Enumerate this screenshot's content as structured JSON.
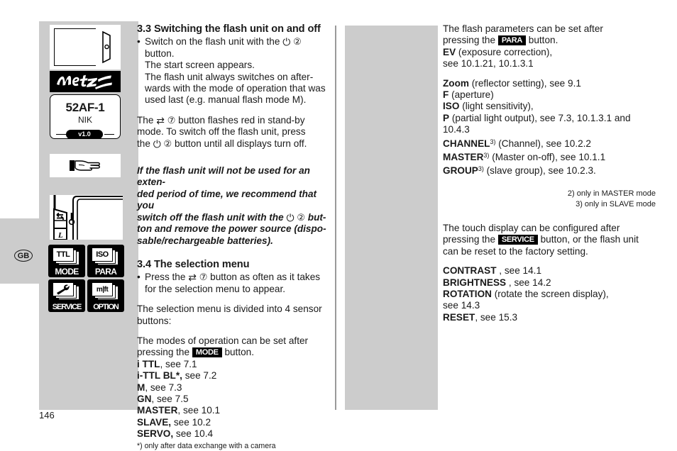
{
  "page": {
    "number": "146",
    "language_tab": "GB"
  },
  "figures": {
    "start_screen": {
      "model": "52AF-1",
      "brand_variant": "NIK",
      "version": "v1.0",
      "logo_text": "Metz"
    },
    "sensor_buttons": [
      {
        "icon_label": "TTL",
        "caption": "MODE"
      },
      {
        "icon_label": "ISO",
        "caption": "PARA"
      },
      {
        "icon_label": "wrench",
        "caption": "SERVICE"
      },
      {
        "icon_label": "m|ft",
        "caption": "OPTION"
      }
    ]
  },
  "middle_column": {
    "section_3_3": {
      "heading": "3.3 Switching the flash unit on and off",
      "bullet_line_1a": "Switch on the flash unit with the",
      "bullet_line_1b": "button.",
      "bullet_line_2": "The start screen appears.",
      "bullet_line_3": "The flash unit always switches on after-",
      "bullet_line_4": "wards with the mode of operation that was",
      "bullet_line_5": "used last (e.g. manual flash mode M).",
      "para_2a": "The",
      "para_2b": "button flashes red in stand-by",
      "para_2c": "mode. To switch off the flash unit, press",
      "para_2d": "the",
      "para_2e": "button until all displays turn off."
    },
    "warning": {
      "line_1": "If the flash unit will not be used for an exten-",
      "line_2": "ded period of time, we recommend that you",
      "line_3": "switch off the flash unit with the",
      "line_4": "but-",
      "line_5": "ton and remove the power source (dispo-",
      "line_6": "sable/rechargeable batteries)."
    },
    "section_3_4": {
      "heading": "3.4 The selection menu",
      "bullet_1a": "Press the",
      "bullet_1b": "button as often as it takes",
      "bullet_1c": "for the selection menu to appear.",
      "para_1a": "The selection menu is divided into 4 sensor",
      "para_1b": "buttons:",
      "para_2a": "The modes of operation can be set after",
      "para_2b": "pressing the",
      "para_2c": "button.",
      "mode_badge": "MODE",
      "modes": [
        {
          "name": "i TTL",
          "ref": ", see 7.1"
        },
        {
          "name": "i-TTL BL*,",
          "ref": " see 7.2"
        },
        {
          "name": "M",
          "ref": ", see 7.3"
        },
        {
          "name": "GN",
          "ref": ", see 7.5"
        },
        {
          "name": "MASTER",
          "ref": ", see 10.1"
        },
        {
          "name": "SLAVE,",
          "ref": " see 10.2"
        },
        {
          "name": "SERVO,",
          "ref": " see 10.4"
        }
      ],
      "footnote": "*) only after data exchange with a camera"
    }
  },
  "right_column": {
    "para_intro_a": "The flash parameters can be set after",
    "para_intro_b": "pressing the",
    "para_intro_c": "button.",
    "para_badge": "PARA",
    "params_first": [
      {
        "name": "EV",
        "ref": " (exposure correction),"
      },
      {
        "name": "",
        "ref": "see 10.1.21, 10.1.3.1"
      }
    ],
    "params": [
      {
        "name": "Zoom",
        "sup": "",
        "ref": " (reflector setting), see 9.1"
      },
      {
        "name": "F",
        "sup": "",
        "ref": " (aperture)"
      },
      {
        "name": "ISO",
        "sup": "",
        "ref": " (light sensitivity),"
      },
      {
        "name": "P",
        "sup": "",
        "ref": " (partial light output), see 7.3, 10.1.3.1 and"
      },
      {
        "name": "",
        "sup": "",
        "ref": "10.4.3"
      },
      {
        "name": "CHANNEL",
        "sup": "3)",
        "ref": " (Channel), see 10.2.2"
      },
      {
        "name": "MASTER",
        "sup": "3)",
        "ref": " (Master on-off), see 10.1.1"
      },
      {
        "name": "GROUP",
        "sup": "3)",
        "ref": " (slave group), see 10.2.3."
      }
    ],
    "footnotes": [
      "2) only in MASTER mode",
      "3) only in SLAVE mode"
    ],
    "para_touch_a": "The touch display can be configured after",
    "para_touch_b": "pressing the",
    "para_touch_c": "button, or the flash unit",
    "para_touch_d": "can be reset to the factory setting.",
    "service_badge": "SERVICE",
    "settings": [
      {
        "name": "CONTRAST",
        "ref": " , see 14.1"
      },
      {
        "name": "BRIGHTNESS",
        "ref": " , see 14.2"
      },
      {
        "name": "ROTATION",
        "ref": " (rotate the screen display),"
      },
      {
        "name": "",
        "ref": "see 14.3"
      },
      {
        "name": "RESET",
        "ref": ", see 15.3"
      }
    ]
  },
  "colors": {
    "panel_gray": "#cccccc",
    "rule_gray": "#9a9a9a",
    "ink": "#1a1a1a"
  }
}
